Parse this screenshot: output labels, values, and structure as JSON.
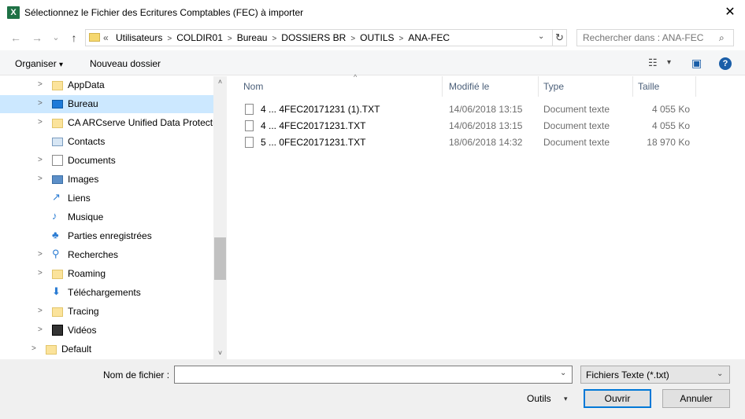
{
  "window": {
    "title": "Sélectionnez le Fichier des Ecritures Comptables (FEC) à importer",
    "close_glyph": "✕",
    "app_icon_letter": "X"
  },
  "navigation": {
    "back_glyph": "←",
    "forward_glyph": "→",
    "recent_glyph": "⌄",
    "up_glyph": "↑"
  },
  "address": {
    "prefix": "«",
    "crumbs": [
      "Utilisateurs",
      "COLDIR01",
      "Bureau",
      "DOSSIERS BR",
      "OUTILS",
      "ANA-FEC"
    ],
    "separator": ">",
    "dropdown_glyph": "⌄",
    "refresh_glyph": "↻"
  },
  "search": {
    "placeholder": "Rechercher dans : ANA-FEC",
    "icon_glyph": "⌕"
  },
  "toolbar": {
    "organize_label": "Organiser",
    "organize_caret": "▾",
    "new_folder_label": "Nouveau dossier",
    "view_glyph": "☷",
    "view_caret": "▾",
    "preview_glyph": "▣",
    "help_glyph": "?"
  },
  "sidebar": {
    "items": [
      {
        "label": "AppData",
        "icon": "folder-icon",
        "chevron": ">"
      },
      {
        "label": "Bureau",
        "icon": "desktop-icon",
        "chevron": ">",
        "selected": true
      },
      {
        "label": "CA ARCserve Unified Data Protection",
        "icon": "folder-icon",
        "chevron": ">"
      },
      {
        "label": "Contacts",
        "icon": "contacts-icon",
        "chevron": ""
      },
      {
        "label": "Documents",
        "icon": "documents-icon",
        "chevron": ">"
      },
      {
        "label": "Images",
        "icon": "pictures-icon",
        "chevron": ">"
      },
      {
        "label": "Liens",
        "icon": "links-icon",
        "chevron": "",
        "glyph": "↗"
      },
      {
        "label": "Musique",
        "icon": "music-icon",
        "chevron": "",
        "glyph": "♪"
      },
      {
        "label": "Parties enregistrées",
        "icon": "saved-games-icon",
        "chevron": "",
        "glyph": "♣"
      },
      {
        "label": "Recherches",
        "icon": "searches-icon",
        "chevron": ">",
        "glyph": "⚲"
      },
      {
        "label": "Roaming",
        "icon": "folder-icon",
        "chevron": ">"
      },
      {
        "label": "Téléchargements",
        "icon": "downloads-icon",
        "chevron": "",
        "glyph": "⬇"
      },
      {
        "label": "Tracing",
        "icon": "folder-icon",
        "chevron": ">"
      },
      {
        "label": "Vidéos",
        "icon": "videos-icon",
        "chevron": ">"
      },
      {
        "label": "Default",
        "icon": "folder-icon",
        "chevron": ">"
      }
    ],
    "scroll_up_glyph": "˄",
    "scroll_down_glyph": "˅"
  },
  "file_list": {
    "columns": {
      "name": "Nom",
      "modified": "Modifié le",
      "type": "Type",
      "size": "Taille"
    },
    "sort_caret": "^",
    "rows": [
      {
        "name": "4 ... 4FEC20171231 (1).TXT",
        "modified": "14/06/2018 13:15",
        "type": "Document texte",
        "size": "4 055 Ko"
      },
      {
        "name": "4 ... 4FEC20171231.TXT",
        "modified": "14/06/2018 13:15",
        "type": "Document texte",
        "size": "4 055 Ko"
      },
      {
        "name": "5 ... 0FEC20171231.TXT",
        "modified": "18/06/2018 14:32",
        "type": "Document texte",
        "size": "18 970 Ko"
      }
    ]
  },
  "footer": {
    "filename_label": "Nom de fichier :",
    "filename_value": "",
    "filename_drop": "⌄",
    "filter_value": "Fichiers Texte (*.txt)",
    "filter_drop": "⌄",
    "tools_label": "Outils",
    "tools_caret": "▾",
    "open_label": "Ouvrir",
    "cancel_label": "Annuler"
  },
  "colors": {
    "selection": "#cce8ff",
    "accent": "#0078d7",
    "header_text": "#4c607a",
    "secondary_text": "#6d6d6d"
  }
}
